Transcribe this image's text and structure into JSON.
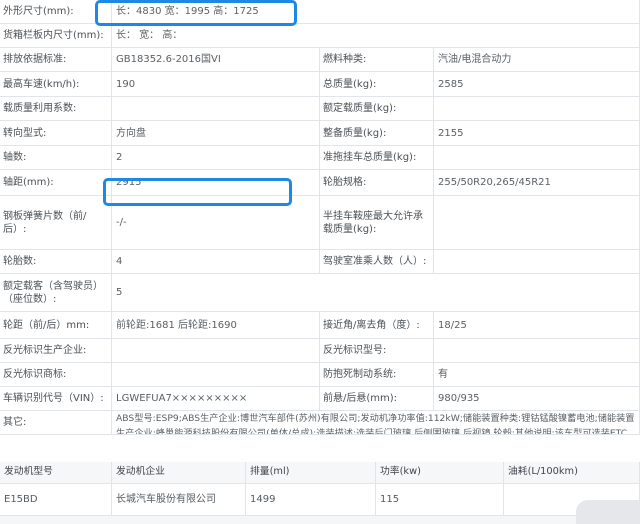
{
  "rows": {
    "r0": {
      "label": "外形尺寸(mm):",
      "value": "长：4830 宽：1995 高：1725"
    },
    "r1": {
      "label": "货箱栏板内尺寸(mm):",
      "value": "长：  宽：  高："
    },
    "r2": {
      "label": "排放依据标准:",
      "value": "GB18352.6-2016国VI",
      "label2": "燃料种类:",
      "value2": "汽油/电混合动力"
    },
    "r3": {
      "label": "最高车速(km/h):",
      "value": "190",
      "label2": "总质量(kg):",
      "value2": "2585"
    },
    "r4": {
      "label": "载质量利用系数:",
      "value": "",
      "label2": "额定载质量(kg):",
      "value2": ""
    },
    "r5": {
      "label": "转向型式:",
      "value": "方向盘",
      "label2": "整备质量(kg):",
      "value2": "2155"
    },
    "r6": {
      "label": "轴数:",
      "value": "2",
      "label2": "准拖挂车总质量(kg):",
      "value2": ""
    },
    "r7": {
      "label": "轴距(mm):",
      "value": "2915",
      "label2": "轮胎规格:",
      "value2": "255/50R20,265/45R21"
    },
    "r8": {
      "label": "钢板弹簧片数（前/后）:",
      "value": "-/-",
      "label2": "半挂车鞍座最大允许承载质量(kg):",
      "value2": ""
    },
    "r9": {
      "label": "轮胎数:",
      "value": "4",
      "label2": "驾驶室准乘人数（人）:",
      "value2": ""
    },
    "r10": {
      "label": "额定载客（含驾驶员）（座位数）:",
      "value": "5"
    },
    "r11": {
      "label": "轮距（前/后）mm:",
      "value": "前轮距:1681 后轮距:1690",
      "label2": "接近角/离去角（度）:",
      "value2": "18/25"
    },
    "r12": {
      "label": "反光标识生产企业:",
      "value": "",
      "label2": "反光标识型号:",
      "value2": ""
    },
    "r13": {
      "label": "反光标识商标:",
      "value": "",
      "label2": "防抱死制动系统:",
      "value2": "有"
    },
    "r14": {
      "label": "车辆识别代号（VIN）:",
      "value": "LGWEFUA7×××××××××",
      "label2": "前悬/后悬(mm):",
      "value2": "980/935"
    },
    "r15": {
      "label": "其它:",
      "value": "ABS型号:ESP9;ABS生产企业:博世汽车部件(苏州)有限公司;发动机净功率值:112kW;储能装置种类:锂钴锰酸镍蓄电池;储能装置生产企业:蜂巢能源科技股份有限公司(单体/总成);选装描述:选装后门玻璃,后侧围玻璃,后视镜,轮毂;其他说明:该车型可选装ETC车载装置;该车配备汽车事件数据记录系统(EDR);允许外接充电."
    }
  },
  "engine": {
    "headers": [
      "发动机型号",
      "发动机企业",
      "排量(ml)",
      "功率(kw)",
      "油耗(L/100km)"
    ],
    "values": [
      "E15BD",
      "长城汽车股份有限公司",
      "1499",
      "115",
      ""
    ]
  }
}
